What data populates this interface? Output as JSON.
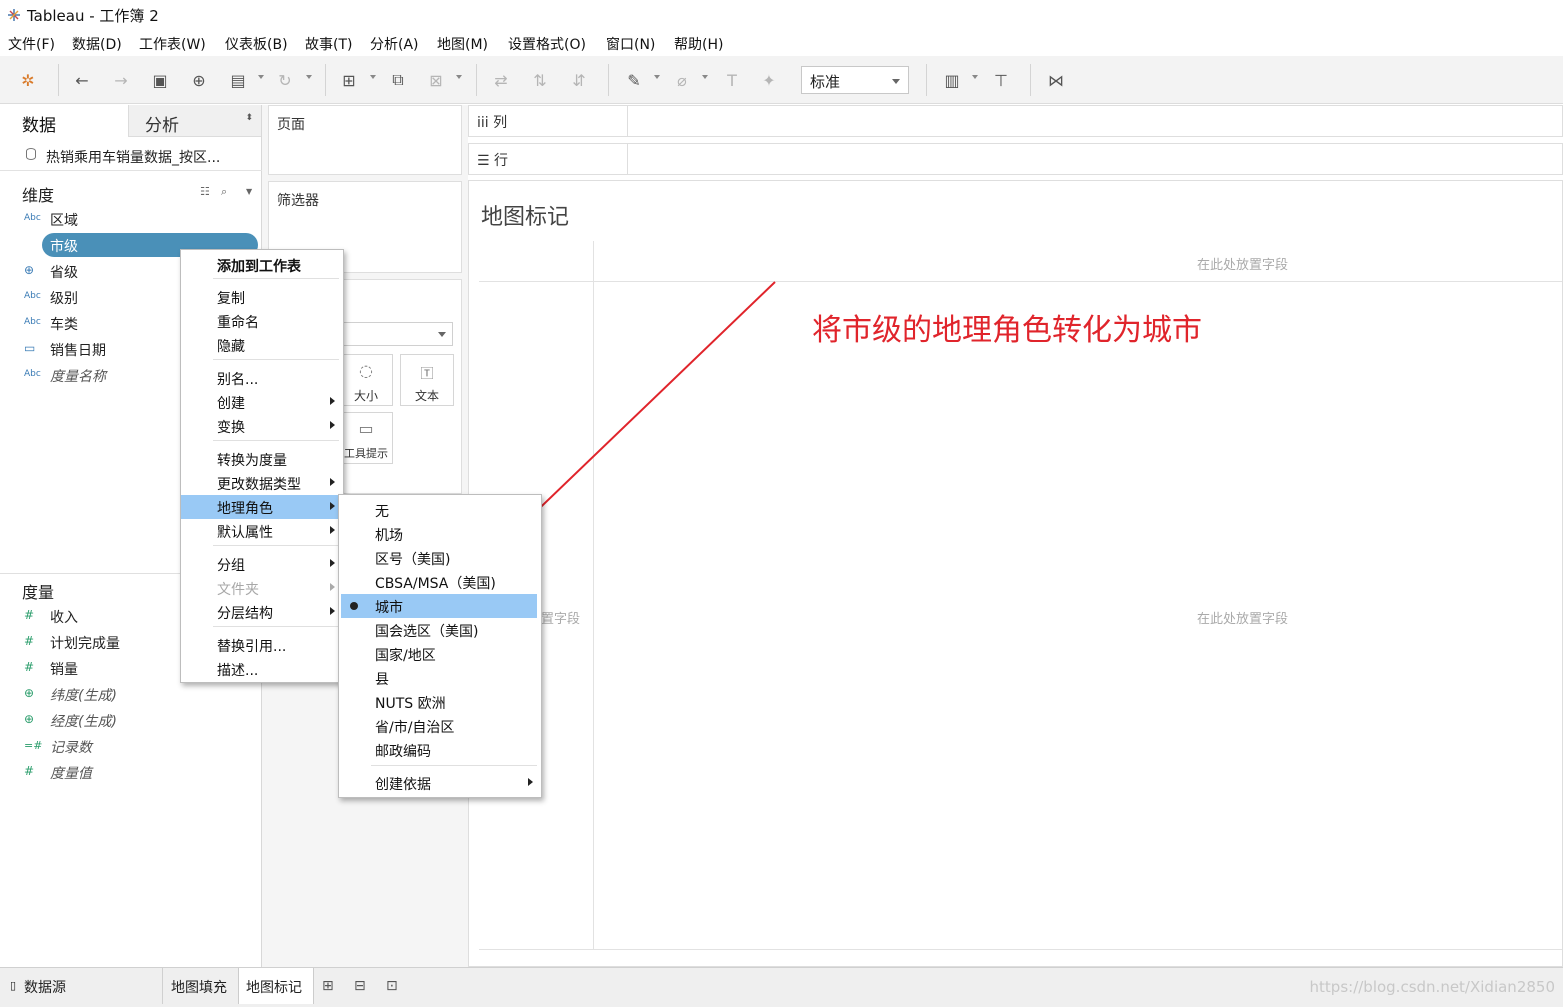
{
  "window": {
    "title": "Tableau - 工作簿 2"
  },
  "menubar": [
    "文件(F)",
    "数据(D)",
    "工作表(W)",
    "仪表板(B)",
    "故事(T)",
    "分析(A)",
    "地图(M)",
    "设置格式(O)",
    "窗口(N)",
    "帮助(H)"
  ],
  "toolbar": {
    "fit_value": "标准"
  },
  "data_pane": {
    "tab_data": "数据",
    "tab_analysis": "分析",
    "datasource": "热销乘用车销量数据_按区...",
    "dimensions_title": "维度",
    "dimensions": [
      {
        "type": "Abc",
        "label": "区域"
      },
      {
        "type": "geo",
        "label": "市级"
      },
      {
        "type": "geo",
        "label": "省级"
      },
      {
        "type": "Abc",
        "label": "级别"
      },
      {
        "type": "Abc",
        "label": "车类"
      },
      {
        "type": "date",
        "label": "销售日期"
      },
      {
        "type": "Abc",
        "label": "度量名称"
      }
    ],
    "measures_title": "度量",
    "measures": [
      {
        "type": "#",
        "label": "收入"
      },
      {
        "type": "#",
        "label": "计划完成量"
      },
      {
        "type": "#",
        "label": "销量"
      },
      {
        "type": "geo",
        "label": "纬度(生成)"
      },
      {
        "type": "geo",
        "label": "经度(生成)"
      },
      {
        "type": "=#",
        "label": "记录数"
      },
      {
        "type": "#",
        "label": "度量值"
      }
    ]
  },
  "shelves": {
    "pages": "页面",
    "filters": "筛选器",
    "columns": "列",
    "rows": "行",
    "marks": {
      "size": "大小",
      "text": "文本",
      "tooltip": "工具提示"
    }
  },
  "view": {
    "title": "地图标记",
    "drop_hint": "在此处放置字段",
    "drop_hint_partial": "置字段",
    "annotation": "将市级的地理角色转化为城市"
  },
  "context_menu": {
    "items": [
      {
        "label": "添加到工作表",
        "bold": true
      },
      {
        "label": "复制"
      },
      {
        "label": "重命名"
      },
      {
        "label": "隐藏"
      },
      {
        "label": "别名..."
      },
      {
        "label": "创建",
        "submenu": true
      },
      {
        "label": "变换",
        "submenu": true
      },
      {
        "label": "转换为度量"
      },
      {
        "label": "更改数据类型",
        "submenu": true
      },
      {
        "label": "地理角色",
        "submenu": true,
        "highlight": true
      },
      {
        "label": "默认属性",
        "submenu": true
      },
      {
        "label": "分组",
        "submenu": true
      },
      {
        "label": "文件夹",
        "submenu": true,
        "disabled": true
      },
      {
        "label": "分层结构",
        "submenu": true
      },
      {
        "label": "替换引用..."
      },
      {
        "label": "描述..."
      }
    ]
  },
  "geo_submenu": {
    "items": [
      {
        "label": "无"
      },
      {
        "label": "机场"
      },
      {
        "label": "区号（美国)"
      },
      {
        "label": "CBSA/MSA（美国)"
      },
      {
        "label": "城市",
        "selected": true
      },
      {
        "label": "国会选区（美国)"
      },
      {
        "label": "国家/地区"
      },
      {
        "label": "县"
      },
      {
        "label": "NUTS 欧洲"
      },
      {
        "label": "省/市/自治区"
      },
      {
        "label": "邮政编码"
      },
      {
        "label": "创建依据",
        "submenu": true
      }
    ]
  },
  "bottom_tabs": {
    "datasource": "数据源",
    "sheets": [
      "地图填充",
      "地图标记"
    ],
    "active": "地图标记"
  },
  "watermark": "https://blog.csdn.net/Xidian2850",
  "colors": {
    "accent": "#4a90b8",
    "highlight": "#99c9f5",
    "annotation": "#e0242b"
  }
}
